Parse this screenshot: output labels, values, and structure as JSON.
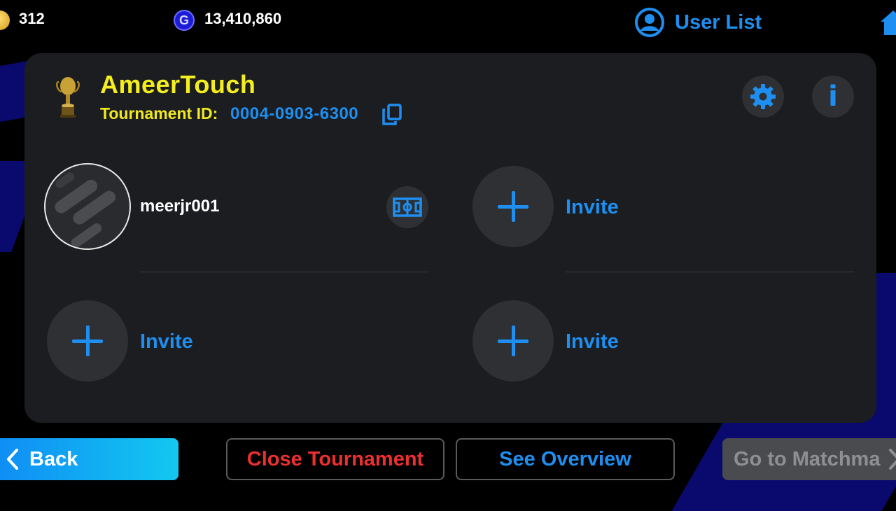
{
  "currency": {
    "coins": "312",
    "gp": "13,410,860",
    "gp_glyph": "G"
  },
  "header": {
    "user_list_label": "User List"
  },
  "tournament": {
    "name": "AmeerTouch",
    "id_label": "Tournament ID:",
    "id_value": "0004-0903-6300"
  },
  "info_button_glyph": "i",
  "slots": [
    {
      "type": "member",
      "name": "meerjr001"
    },
    {
      "type": "invite",
      "label": "Invite"
    },
    {
      "type": "invite",
      "label": "Invite"
    },
    {
      "type": "invite",
      "label": "Invite"
    }
  ],
  "footer": {
    "back_label": "Back",
    "close_label": "Close Tournament",
    "overview_label": "See Overview",
    "matchmaking_label": "Go to Matchma"
  },
  "colors": {
    "accent_blue": "#1e8ff0",
    "title_yellow": "#f4ee1e",
    "close_red": "#ec2f2f",
    "panel_bg": "#1c1d20"
  }
}
